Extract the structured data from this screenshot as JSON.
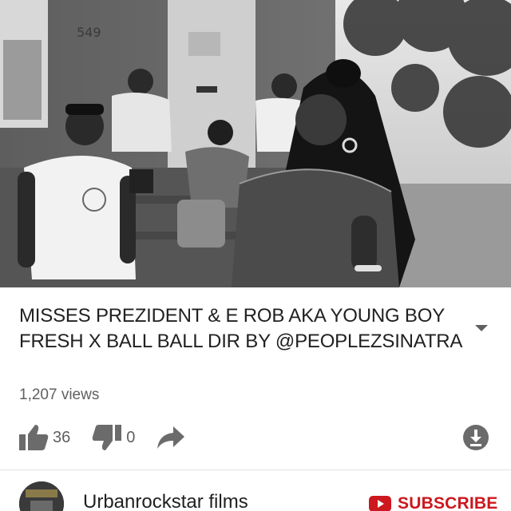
{
  "video": {
    "title": "MISSES PREZIDENT & E ROB AKA YOUNG BOY FRESH X BALL BALL DIR BY @PEOPLEZSINATRA",
    "views": "1,207 views"
  },
  "actions": {
    "like_icon": "thumbs-up-icon",
    "like_count": "36",
    "dislike_icon": "thumbs-down-icon",
    "dislike_count": "0",
    "share_icon": "share-arrow-icon",
    "download_icon": "download-icon",
    "expand_icon": "chevron-down-icon"
  },
  "channel": {
    "name": "Urbanrockstar films",
    "subscribe_label": "SUBSCRIBE",
    "subscribe_icon": "youtube-play-icon"
  },
  "colors": {
    "text_primary": "#212121",
    "text_secondary": "#606060",
    "icon_gray": "#6b6b6b",
    "subscribe_red": "#cc181e"
  },
  "player": {
    "frame_text": {
      "door_number": "549"
    }
  }
}
